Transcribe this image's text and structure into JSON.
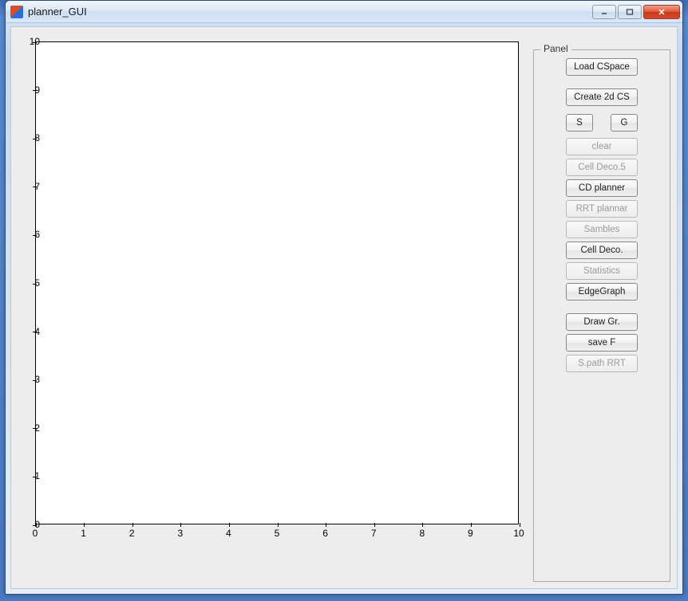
{
  "window": {
    "title": "planner_GUI"
  },
  "chart_data": {
    "type": "scatter",
    "x": [],
    "y": [],
    "xlim": [
      0,
      10
    ],
    "ylim": [
      0,
      10
    ],
    "xticks": [
      0,
      1,
      2,
      3,
      4,
      5,
      6,
      7,
      8,
      9,
      10
    ],
    "yticks": [
      0,
      1,
      2,
      3,
      4,
      5,
      6,
      7,
      8,
      9,
      10
    ],
    "title": "",
    "xlabel": "",
    "ylabel": ""
  },
  "panel": {
    "title": "Panel",
    "buttons": {
      "load_cspace": "Load CSpace",
      "create_2d_cs": "Create 2d CS",
      "s": "S",
      "g": "G",
      "clear": "clear",
      "cell_deco5": "Cell Deco.5",
      "cd_planner": "CD planner",
      "rrt_plannar": "RRT plannar",
      "sambles": "Sambles",
      "cell_deco": "Cell Deco.",
      "statistics": "Statistics",
      "edgegraph": "EdgeGraph",
      "draw_gr": "Draw Gr.",
      "save_f": "save F",
      "spath_rrt": "S.path RRT"
    }
  }
}
